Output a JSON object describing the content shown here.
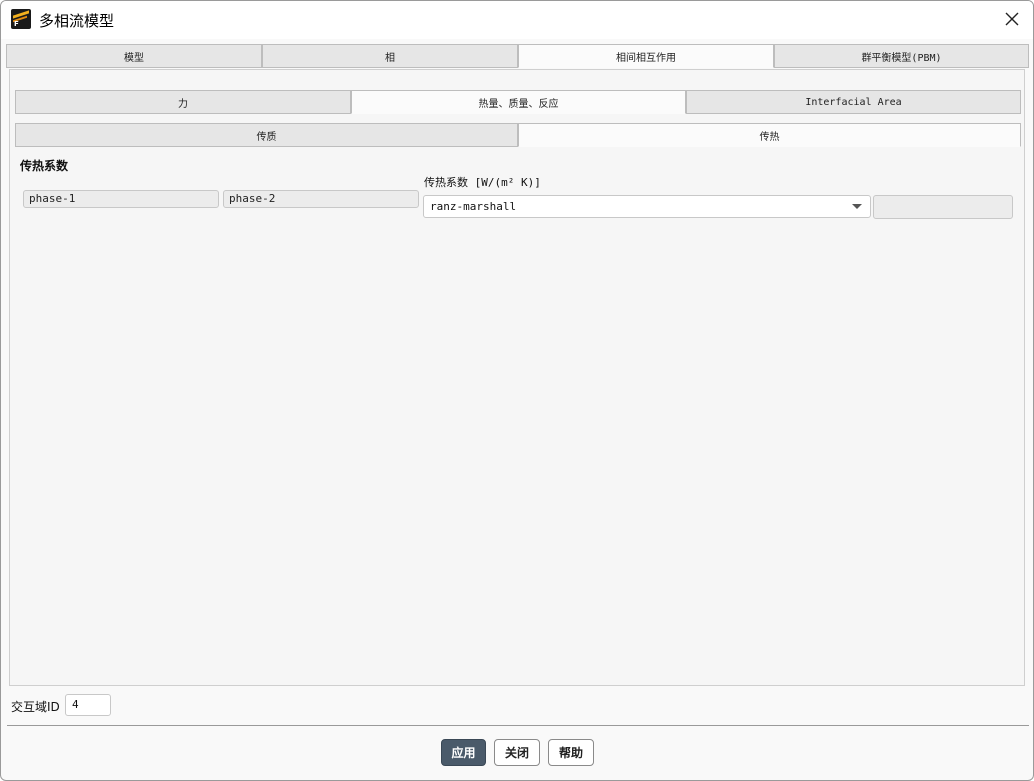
{
  "window": {
    "title": "多相流模型"
  },
  "main_tabs": [
    {
      "label": "模型"
    },
    {
      "label": "相"
    },
    {
      "label": "相间相互作用"
    },
    {
      "label": "群平衡模型(PBM)"
    }
  ],
  "sub_tabs": [
    {
      "label": "力"
    },
    {
      "label": "热量、质量、反应"
    },
    {
      "label": "Interfacial Area"
    }
  ],
  "sub_sub_tabs": [
    {
      "label": "传质"
    },
    {
      "label": "传热"
    }
  ],
  "heat_transfer": {
    "section_label": "传热系数",
    "phase_1": "phase-1",
    "phase_2": "phase-2",
    "coef_label": "传热系数 [W/(m² K)]",
    "coef_value": "ranz-marshall"
  },
  "zone": {
    "label": "交互域ID",
    "value": "4"
  },
  "buttons": {
    "apply": "应用",
    "close": "关闭",
    "help": "帮助"
  },
  "colors": {
    "primary_button": "#4a5a6a",
    "window_bg": "#f9f9f9"
  },
  "icons": {
    "app": "fluent-app-icon",
    "close": "close-icon",
    "dropdown": "chevron-down-icon"
  }
}
